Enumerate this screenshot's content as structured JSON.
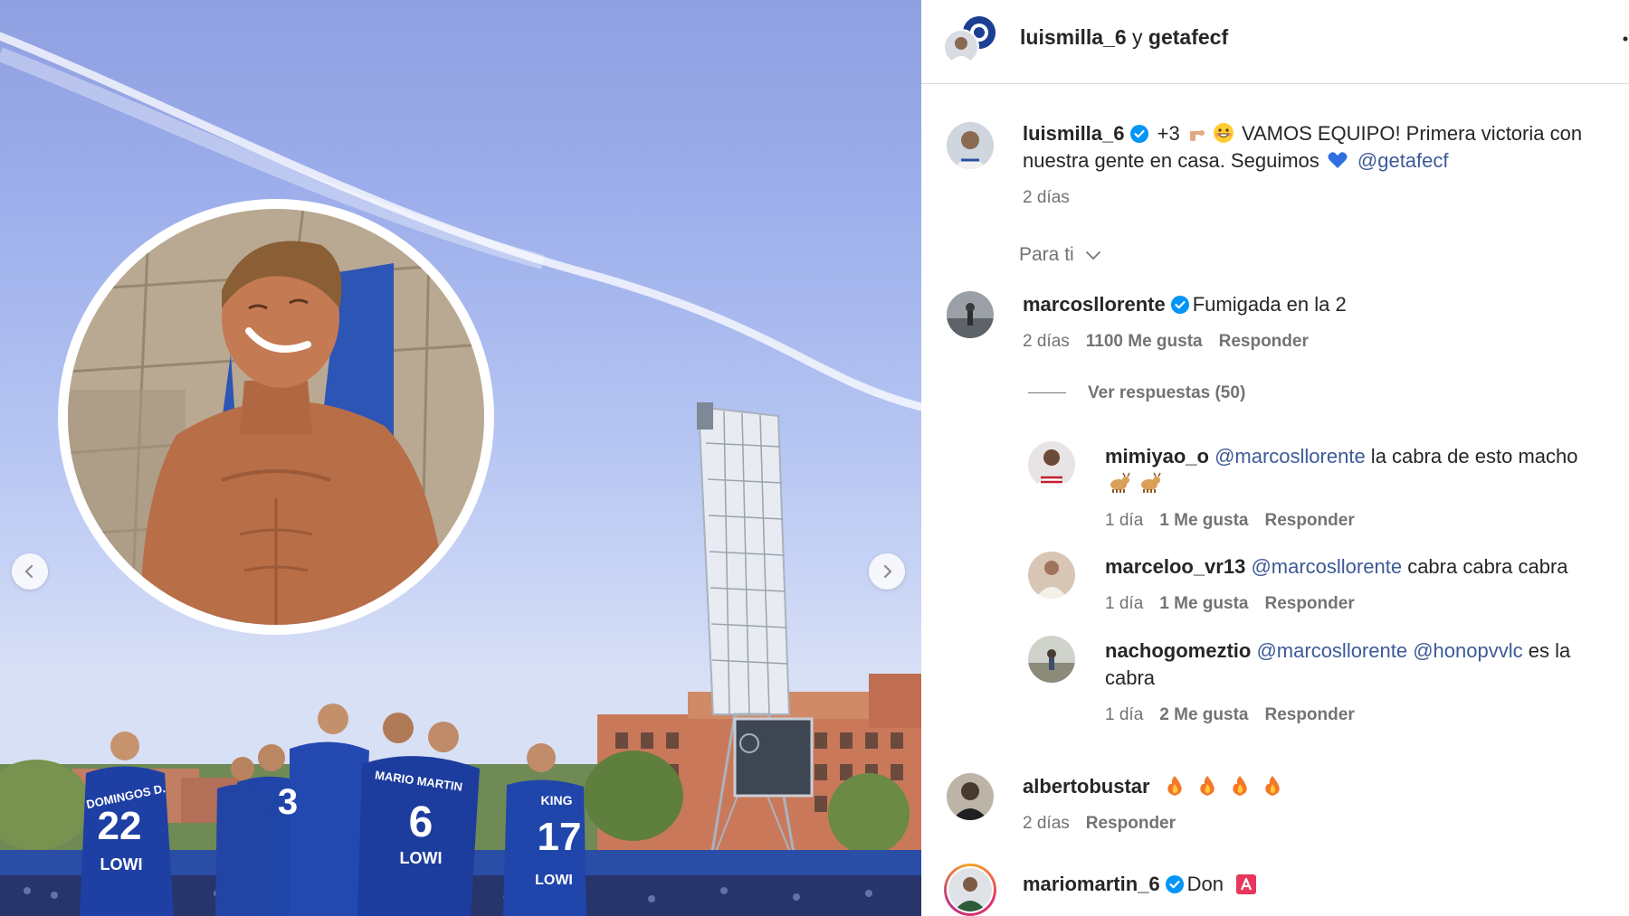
{
  "colors": {
    "text": "#262626",
    "meta": "#737373",
    "mention": "#3d5a98",
    "verified": "#0095f6",
    "divider": "#dbdbdb",
    "kit_blue": "#1e3fa3",
    "sky": "#b2c2f1"
  },
  "photo": {
    "prev_icon": "chevron-left-icon",
    "next_icon": "chevron-right-icon",
    "jerseys": {
      "p1_name": "DOMINGOS D.",
      "p1_number": "22",
      "p2_number": "3",
      "p3_name": "MARIO MARTIN",
      "p3_number": "6",
      "p4_name": "KING",
      "p4_number": "17",
      "sponsor": "LOWI"
    }
  },
  "header": {
    "user1": "luismilla_6",
    "conjunction": "y",
    "user2": "getafecf",
    "more_icon": "more-icon"
  },
  "caption": {
    "username": "luismilla_6",
    "text_prefix": " +3 ",
    "text_main": " VAMOS EQUIPO! Primera victoria con",
    "text_line2": "nuestra gente en casa. Seguimos ",
    "mention": "@getafecf",
    "time": "2 días"
  },
  "sort": {
    "label": "Para ti",
    "icon": "chevron-down-icon"
  },
  "comments": [
    {
      "username": "marcosllorente",
      "verified": true,
      "text": "Fumigada en la 2",
      "time": "2 días",
      "likes": "1100 Me gusta",
      "reply": "Responder"
    },
    {
      "username": "albertobustar",
      "text": "",
      "time": "2 días",
      "reply": "Responder"
    },
    {
      "username": "mariomartin_6",
      "verified": true,
      "text": "Don"
    }
  ],
  "view_replies": "Ver respuestas (50)",
  "replies": [
    {
      "username": "mimiyao_o",
      "mention": "@marcosllorente",
      "text": " la cabra de esto macho",
      "time": "1 día",
      "likes": "1 Me gusta",
      "reply": "Responder"
    },
    {
      "username": "marceloo_vr13",
      "mention": "@marcosllorente",
      "text": " cabra cabra cabra",
      "time": "1 día",
      "likes": "1 Me gusta",
      "reply": "Responder"
    },
    {
      "username": "nachogomeztio",
      "mention": "@marcosllorente",
      "mention2": "@honopvvlc",
      "text": " es la",
      "text_line2": "cabra",
      "time": "1 día",
      "likes": "2 Me gusta",
      "reply": "Responder"
    }
  ]
}
